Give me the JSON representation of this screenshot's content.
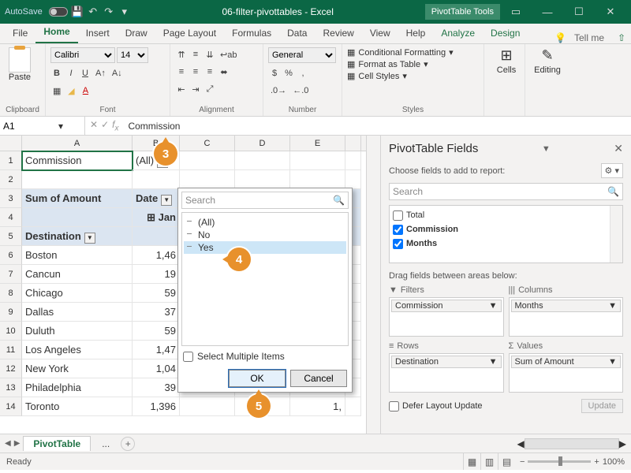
{
  "titlebar": {
    "autosave": "AutoSave",
    "title": "06-filter-pivottables - Excel",
    "contextual": "PivotTable Tools"
  },
  "tabs": {
    "file": "File",
    "home": "Home",
    "insert": "Insert",
    "draw": "Draw",
    "pagelayout": "Page Layout",
    "formulas": "Formulas",
    "data": "Data",
    "review": "Review",
    "view": "View",
    "help": "Help",
    "analyze": "Analyze",
    "design": "Design",
    "tellme": "Tell me"
  },
  "ribbon": {
    "clipboard": "Clipboard",
    "font": "Font",
    "alignment": "Alignment",
    "number": "Number",
    "styles": "Styles",
    "cells": "Cells",
    "editing": "Editing",
    "paste": "Paste",
    "fontname": "Calibri",
    "fontsize": "14",
    "numformat": "General",
    "condfmt": "Conditional Formatting",
    "fmttable": "Format as Table",
    "cellstyles": "Cell Styles"
  },
  "namebox": "A1",
  "fxvalue": "Commission",
  "grid": {
    "cols": [
      "A",
      "B",
      "C",
      "D",
      "E"
    ],
    "r1": {
      "A": "Commission",
      "B": "(All)"
    },
    "r3": {
      "A": "Sum of Amount",
      "B": "Date"
    },
    "r4": {
      "A": "",
      "B": "Jan"
    },
    "r5": {
      "A": "Destination"
    },
    "rows": [
      {
        "n": "6",
        "dest": "Boston",
        "val": "1,46"
      },
      {
        "n": "7",
        "dest": "Cancun",
        "val": "19"
      },
      {
        "n": "8",
        "dest": "Chicago",
        "val": "59"
      },
      {
        "n": "9",
        "dest": "Dallas",
        "val": "37"
      },
      {
        "n": "10",
        "dest": "Duluth",
        "val": "59"
      },
      {
        "n": "11",
        "dest": "Los Angeles",
        "val": "1,47"
      },
      {
        "n": "12",
        "dest": "New York",
        "val": "1,04"
      },
      {
        "n": "13",
        "dest": "Philadelphia",
        "val": "39"
      },
      {
        "n": "14",
        "dest": "Toronto",
        "val": "1,396"
      }
    ],
    "lastE": "1,"
  },
  "popup": {
    "search": "Search",
    "items": {
      "all": "(All)",
      "no": "No",
      "yes": "Yes"
    },
    "multi": "Select Multiple Items",
    "ok": "OK",
    "cancel": "Cancel"
  },
  "fields": {
    "title": "PivotTable Fields",
    "choose": "Choose fields to add to report:",
    "search": "Search",
    "list": {
      "total": "Total",
      "commission": "Commission",
      "months": "Months"
    },
    "draghint": "Drag fields between areas below:",
    "filters": "Filters",
    "columns": "Columns",
    "rows": "Rows",
    "values": "Values",
    "chip_filters": "Commission",
    "chip_columns": "Months",
    "chip_rows": "Destination",
    "chip_values": "Sum of Amount",
    "defer": "Defer Layout Update",
    "update": "Update"
  },
  "sheetTabs": {
    "active": "PivotTable",
    "more": "..."
  },
  "status": {
    "ready": "Ready",
    "zoom": "100%"
  },
  "badges": {
    "b3": "3",
    "b4": "4",
    "b5": "5"
  }
}
